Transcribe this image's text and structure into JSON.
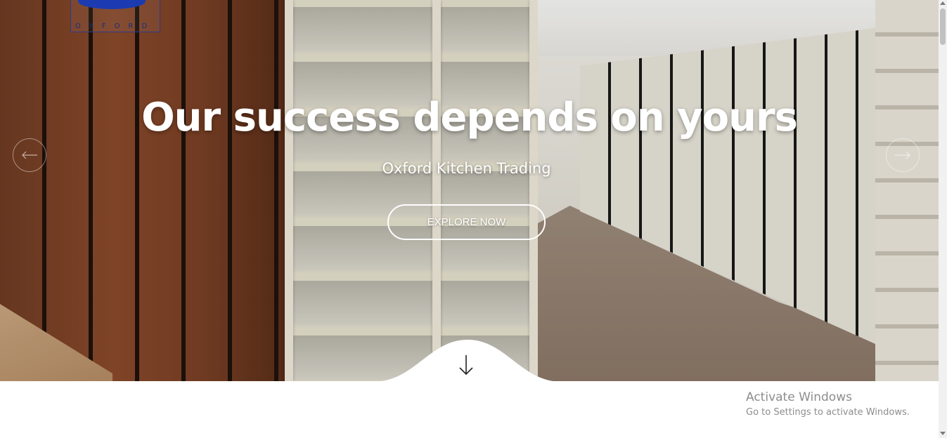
{
  "brand": {
    "logo_text": "OXFORD"
  },
  "hero": {
    "headline": "Our success depends on yours",
    "subheadline": "Oxford Kitchen Trading",
    "cta_label": "EXPLORE NOW",
    "prev_icon": "arrow-left-icon",
    "next_icon": "arrow-right-icon",
    "scroll_icon": "arrow-down-icon"
  },
  "os_notice": {
    "title": "Activate Windows",
    "subtitle": "Go to Settings to activate Windows."
  }
}
